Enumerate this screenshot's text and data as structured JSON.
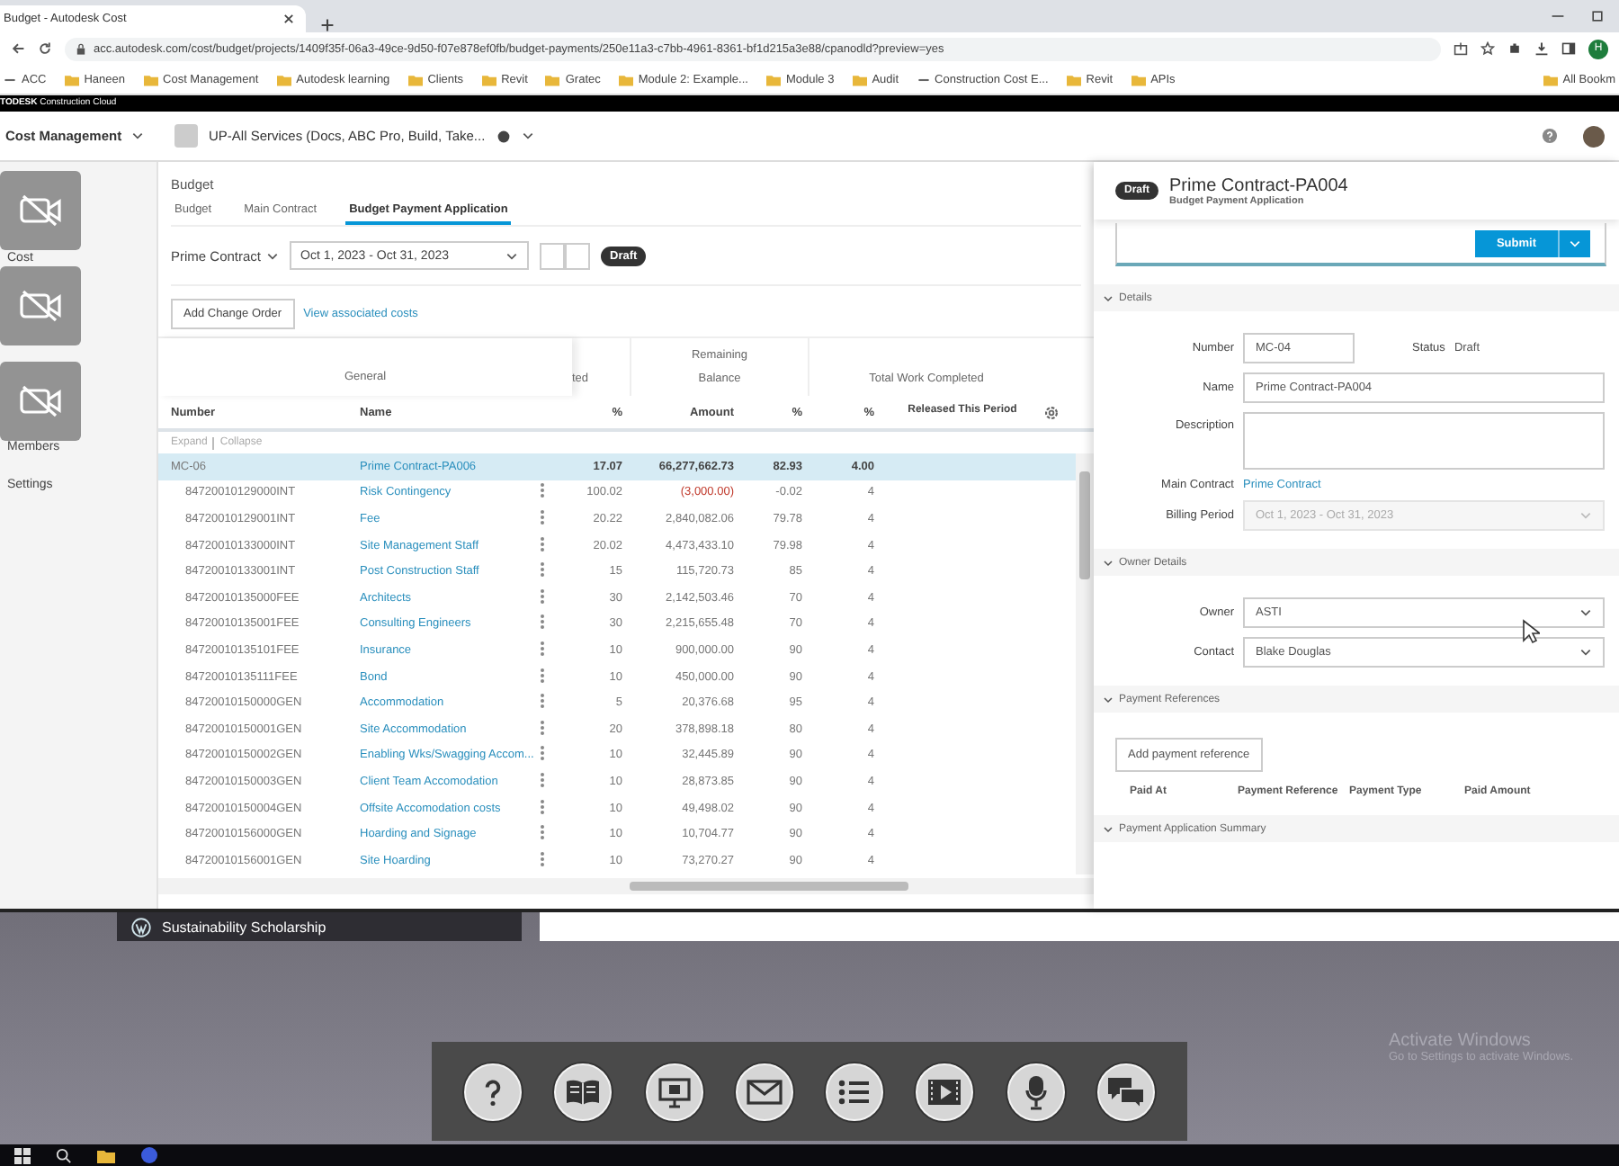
{
  "browser": {
    "tab_title": "Budget - Autodesk Cost",
    "url": "acc.autodesk.com/cost/budget/projects/1409f35f-06a3-49ce-9d50-f07e878ef0fb/budget-payments/250e11a3-c7bb-4961-8361-bf1d215a3e88/cpanodld?preview=yes",
    "profile_initial": "H",
    "bookmarks": [
      {
        "label": "ACC",
        "kind": "site"
      },
      {
        "label": "Haneen",
        "kind": "folder"
      },
      {
        "label": "Cost Management",
        "kind": "folder"
      },
      {
        "label": "Autodesk learning",
        "kind": "folder"
      },
      {
        "label": "Clients",
        "kind": "folder"
      },
      {
        "label": "Revit",
        "kind": "folder"
      },
      {
        "label": "Gratec",
        "kind": "folder"
      },
      {
        "label": "Module 2: Example...",
        "kind": "folder"
      },
      {
        "label": "Module 3",
        "kind": "folder"
      },
      {
        "label": "Audit",
        "kind": "folder"
      },
      {
        "label": "Construction Cost E...",
        "kind": "site"
      },
      {
        "label": "Revit",
        "kind": "folder"
      },
      {
        "label": "APIs",
        "kind": "folder"
      }
    ],
    "all_bookmarks": "All Bookm"
  },
  "app": {
    "brand": "**TODESK** Construction Cloud",
    "module": "Cost Management",
    "project": "UP-All Services (Docs, ABC Pro, Build, Take..."
  },
  "sidebar": {
    "items": [
      {
        "label": "Cost"
      },
      {
        "label": "Members"
      },
      {
        "label": "Settings"
      }
    ]
  },
  "video_tiles": [
    {
      "camera_off": true
    },
    {
      "camera_off": true
    },
    {
      "camera_off": true
    }
  ],
  "page": {
    "heading": "Budget",
    "tabs": [
      {
        "label": "Budget",
        "selected": false
      },
      {
        "label": "Main Contract",
        "selected": false
      },
      {
        "label": "Budget Payment Application",
        "selected": true
      }
    ],
    "contract_filter": "Prime Contract",
    "period": "Oct 1, 2023 - Oct 31, 2023",
    "status_badge": "Draft",
    "add_button": "Add Change Order",
    "link": "View associated costs"
  },
  "table": {
    "groups": [
      "General",
      "ted",
      "Remaining",
      "Balance",
      "Total Work Completed"
    ],
    "columns": [
      "Number",
      "Name",
      "%",
      "Amount",
      "%",
      "%",
      "Released This Period"
    ],
    "expand": "Expand",
    "collapse": "Collapse",
    "rows": [
      {
        "number": "MC-06",
        "name": "Prime Contract-PA006",
        "pct": "17.07",
        "amount": "66,277,662.73",
        "balance_pct": "82.93",
        "work_pct": "4.00",
        "selected": true,
        "negative": false
      },
      {
        "number": "84720010129000INT",
        "name": "Risk Contingency",
        "pct": "100.02",
        "amount": "(3,000.00)",
        "balance_pct": "-0.02",
        "work_pct": "4",
        "selected": false,
        "negative": true
      },
      {
        "number": "84720010129001INT",
        "name": "Fee",
        "pct": "20.22",
        "amount": "2,840,082.06",
        "balance_pct": "79.78",
        "work_pct": "4",
        "selected": false,
        "negative": false
      },
      {
        "number": "84720010133000INT",
        "name": "Site Management Staff",
        "pct": "20.02",
        "amount": "4,473,433.10",
        "balance_pct": "79.98",
        "work_pct": "4",
        "selected": false,
        "negative": false
      },
      {
        "number": "84720010133001INT",
        "name": "Post Construction Staff",
        "pct": "15",
        "amount": "115,720.73",
        "balance_pct": "85",
        "work_pct": "4",
        "selected": false,
        "negative": false
      },
      {
        "number": "84720010135000FEE",
        "name": "Architects",
        "pct": "30",
        "amount": "2,142,503.46",
        "balance_pct": "70",
        "work_pct": "4",
        "selected": false,
        "negative": false
      },
      {
        "number": "84720010135001FEE",
        "name": "Consulting Engineers",
        "pct": "30",
        "amount": "2,215,655.48",
        "balance_pct": "70",
        "work_pct": "4",
        "selected": false,
        "negative": false
      },
      {
        "number": "84720010135101FEE",
        "name": "Insurance",
        "pct": "10",
        "amount": "900,000.00",
        "balance_pct": "90",
        "work_pct": "4",
        "selected": false,
        "negative": false
      },
      {
        "number": "84720010135111FEE",
        "name": "Bond",
        "pct": "10",
        "amount": "450,000.00",
        "balance_pct": "90",
        "work_pct": "4",
        "selected": false,
        "negative": false
      },
      {
        "number": "84720010150000GEN",
        "name": "Accommodation",
        "pct": "5",
        "amount": "20,376.68",
        "balance_pct": "95",
        "work_pct": "4",
        "selected": false,
        "negative": false
      },
      {
        "number": "84720010150001GEN",
        "name": "Site Accommodation",
        "pct": "20",
        "amount": "378,898.18",
        "balance_pct": "80",
        "work_pct": "4",
        "selected": false,
        "negative": false
      },
      {
        "number": "84720010150002GEN",
        "name": "Enabling Wks/Swagging Accom...",
        "pct": "10",
        "amount": "32,445.89",
        "balance_pct": "90",
        "work_pct": "4",
        "selected": false,
        "negative": false
      },
      {
        "number": "84720010150003GEN",
        "name": "Client Team Accomodation",
        "pct": "10",
        "amount": "28,873.85",
        "balance_pct": "90",
        "work_pct": "4",
        "selected": false,
        "negative": false
      },
      {
        "number": "84720010150004GEN",
        "name": "Offsite Accomodation costs",
        "pct": "10",
        "amount": "49,498.02",
        "balance_pct": "90",
        "work_pct": "4",
        "selected": false,
        "negative": false
      },
      {
        "number": "84720010156000GEN",
        "name": "Hoarding and Signage",
        "pct": "10",
        "amount": "10,704.77",
        "balance_pct": "90",
        "work_pct": "4",
        "selected": false,
        "negative": false
      },
      {
        "number": "84720010156001GEN",
        "name": "Site Hoarding",
        "pct": "10",
        "amount": "73,270.27",
        "balance_pct": "90",
        "work_pct": "4",
        "selected": false,
        "negative": false
      }
    ]
  },
  "panel": {
    "badge": "Draft",
    "title": "Prime Contract-PA004",
    "subtitle": "Budget Payment Application",
    "submit": "Submit",
    "details": {
      "title": "Details",
      "expanded": true,
      "number_label": "Number",
      "number": "MC-04",
      "status_label": "Status",
      "status": "Draft",
      "name_label": "Name",
      "name": "Prime Contract-PA004",
      "description_label": "Description",
      "main_contract_label": "Main Contract",
      "main_contract": "Prime Contract",
      "billing_label": "Billing Period",
      "billing": "Oct 1, 2023 - Oct 31, 2023"
    },
    "owner": {
      "title": "Owner Details",
      "expanded": true,
      "owner_label": "Owner",
      "owner": "ASTI",
      "contact_label": "Contact",
      "contact": "Blake Douglas"
    },
    "payments": {
      "title": "Payment References",
      "expanded": true,
      "button": "Add payment reference",
      "columns": [
        "Paid At",
        "Payment Reference",
        "Payment Type",
        "Paid Amount"
      ]
    },
    "summary": {
      "title": "Payment Application Summary",
      "expanded": true
    }
  },
  "desktop": {
    "banner": "Sustainability Scholarship",
    "toolbar": [
      {
        "kind": "help"
      },
      {
        "kind": "book"
      },
      {
        "kind": "presentation"
      },
      {
        "kind": "mail"
      },
      {
        "kind": "list"
      },
      {
        "kind": "video"
      },
      {
        "kind": "microphone"
      },
      {
        "kind": "chat"
      }
    ],
    "activation_title": "Activate Windows",
    "activation_hint": "Go to Settings to activate Windows."
  }
}
